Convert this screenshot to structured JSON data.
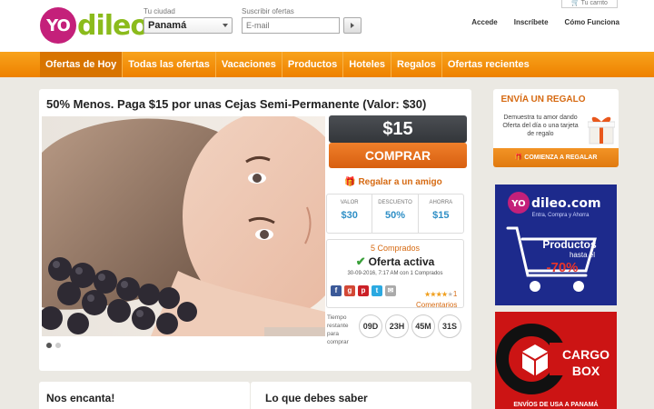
{
  "header": {
    "logo_yo": "YO",
    "logo_dileo": "dileo",
    "city_label": "Tu ciudad",
    "city_value": "Panamá",
    "subscribe_label": "Suscribir ofertas",
    "email_placeholder": "E-mail",
    "cart": "Tu carrito",
    "links": [
      "Accede",
      "Inscríbete",
      "Cómo Funciona"
    ]
  },
  "nav": {
    "items": [
      "Ofertas de Hoy",
      "Todas las ofertas",
      "Vacaciones",
      "Productos",
      "Hoteles",
      "Regalos",
      "Ofertas recientes"
    ]
  },
  "deal": {
    "title": "50% Menos. Paga $15 por unas Cejas Semi-Permanente (Valor: $30)",
    "price": "$15",
    "buy_label": "COMPRAR",
    "gift_link": "Regalar a un amigo",
    "stats": [
      {
        "label": "VALOR",
        "value": "$30"
      },
      {
        "label": "DESCUENTO",
        "value": "50%"
      },
      {
        "label": "AHORRA",
        "value": "$15"
      }
    ],
    "sold": "5 Comprados",
    "status": "Oferta activa",
    "dateline": "30-09-2016, 7:17 AM con 1 Comprados",
    "rating_count": "1",
    "comments": "Comentarios",
    "timer_label": "Tiempo restante para comprar",
    "timer": [
      "09D",
      "23H",
      "45M",
      "31S"
    ]
  },
  "panels": {
    "left_title": "Nos encanta!",
    "right_title": "Lo que debes saber"
  },
  "sidebar": {
    "gift_title": "ENVÍA UN REGALO",
    "gift_desc": "Demuestra tu amor dando Oferta del día o una tarjeta de regalo",
    "gift_button": "COMIENZA A REGALAR",
    "ad1": {
      "brand_yo": "YO",
      "brand": "dileo.com",
      "tagline": "Entra, Compra y Ahorra",
      "headline": "Productos",
      "sub": "hasta el",
      "discount": "-70%"
    },
    "ad2": {
      "brand1": "CARGO",
      "brand2": "BOX",
      "footer": "ENVÍOS DE USA A PANAMÁ"
    }
  },
  "colors": {
    "accent": "#f08c0f",
    "brand_pink": "#c4207a",
    "brand_green": "#8bbb1c",
    "link_blue": "#2f8fc6"
  }
}
